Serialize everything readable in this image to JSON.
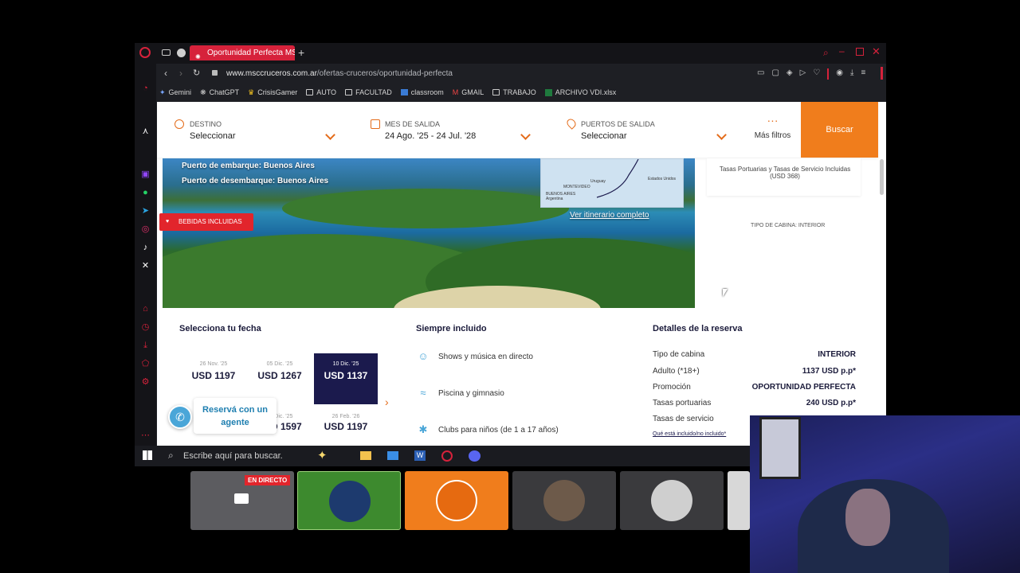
{
  "browser": {
    "tab_title": "Oportunidad Perfecta MSC",
    "url_host": "www.msccruceros.com.ar",
    "url_path": "/ofertas-cruceros/oportunidad-perfecta",
    "bookmarks": [
      "Gemini",
      "ChatGPT",
      "CrisisGamer",
      "AUTO",
      "FACULTAD",
      "classroom",
      "GMAIL",
      "TRABAJO",
      "ARCHIVO VDI.xlsx"
    ]
  },
  "filters": {
    "destino": {
      "label": "DESTINO",
      "value": "Seleccionar"
    },
    "mes": {
      "label": "MES DE SALIDA",
      "value": "24 Ago. '25 - 24 Jul. '28"
    },
    "puertos": {
      "label": "PUERTOS DE SALIDA",
      "value": "Seleccionar"
    },
    "mas_filtros": "Más filtros",
    "buscar": "Buscar"
  },
  "hero": {
    "embarque": "Puerto de embarque: Buenos Aires",
    "desembarque": "Puerto de desembarque: Buenos Aires",
    "badge": "BEBIDAS INCLUIDAS",
    "itinerary_link": "Ver itinerario completo",
    "map_labels": [
      "MONTEVIDEO",
      "Uruguay",
      "BUENOS AIRES Argentina",
      "Estados Unidos"
    ]
  },
  "side_panel": {
    "tasas": "Tasas Portuarias y Tasas de Servicio Incluidas (USD 368)",
    "cabina": "TIPO DE CABINA: INTERIOR"
  },
  "fechas": {
    "title": "Selecciona tu fecha",
    "cards": [
      {
        "date": "26 Nov. '25",
        "price": "USD 1197",
        "selected": false
      },
      {
        "date": "05 Dic. '25",
        "price": "USD 1267",
        "selected": false
      },
      {
        "date": "10 Dic. '25",
        "price": "USD 1137",
        "selected": true
      },
      {
        "date": "14 Dic. '25",
        "price": "USD 1597",
        "selected": false
      },
      {
        "date": "26 Feb. '26",
        "price": "USD 1197",
        "selected": false
      }
    ],
    "agent_button": "Reservá con un agente"
  },
  "incluido": {
    "title": "Siempre incluido",
    "items": [
      "Shows y música en directo",
      "Piscina y gimnasio",
      "Clubs para niños (de 1 a 17 años)"
    ]
  },
  "detalles": {
    "title": "Detalles de la reserva",
    "rows": [
      {
        "label": "Tipo de cabina",
        "value": "INTERIOR"
      },
      {
        "label": "Adulto (*18+)",
        "value": "1137 USD p.p*"
      },
      {
        "label": "Promoción",
        "value": "OPORTUNIDAD PERFECTA"
      },
      {
        "label": "Tasas portuarias",
        "value": "240 USD p.p*"
      },
      {
        "label": "Tasas de servicio",
        "value": ""
      }
    ],
    "link": "Qué está incluido/no incluido*"
  },
  "taskbar": {
    "search_placeholder": "Escribe aquí para buscar."
  },
  "stream": {
    "live_label": "EN DIRECTO"
  },
  "colors": {
    "accent": "#f07d1c",
    "brand_red": "#d6223b",
    "navy": "#1b1a4d"
  }
}
